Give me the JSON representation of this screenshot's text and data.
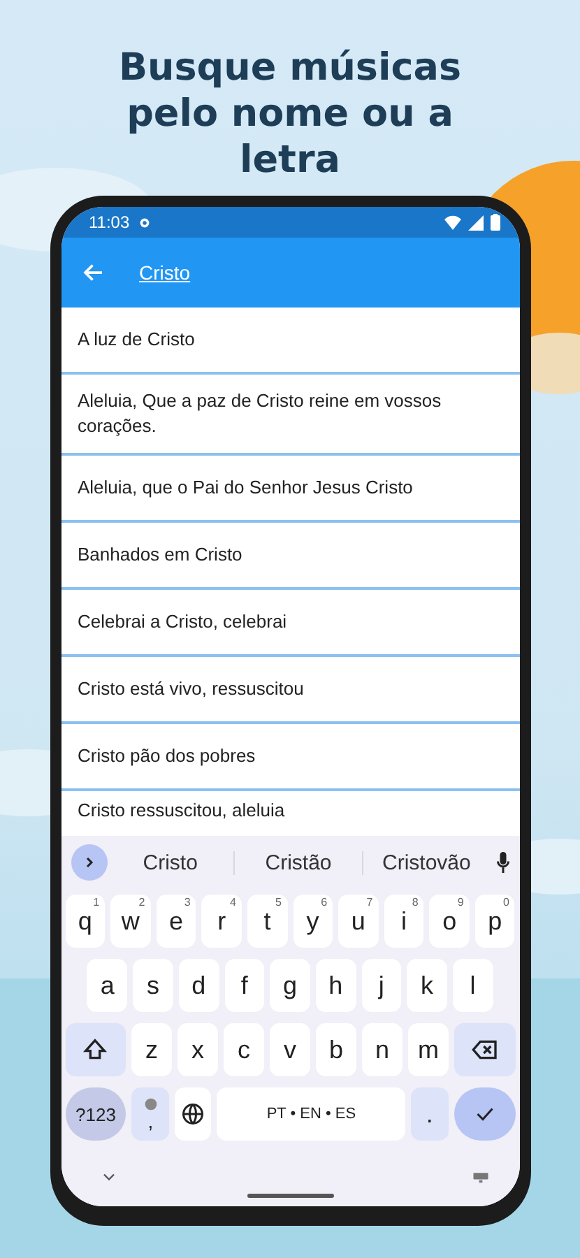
{
  "headline": "Busque músicas pelo nome ou a letra",
  "status_bar": {
    "time": "11:03"
  },
  "app_bar": {
    "title": "Cristo"
  },
  "results": [
    "A luz de Cristo",
    "Aleluia, Que a paz de Cristo reine em vossos corações.",
    "Aleluia, que o Pai do Senhor Jesus Cristo",
    "Banhados em Cristo",
    "Celebrai a Cristo, celebrai",
    "Cristo está vivo, ressuscitou",
    "Cristo pão dos pobres",
    "Cristo ressuscitou, aleluia"
  ],
  "keyboard": {
    "suggestions": [
      "Cristo",
      "Cristão",
      "Cristovão"
    ],
    "rows": [
      [
        {
          "kind": "letter",
          "label": "q",
          "hint": "1"
        },
        {
          "kind": "letter",
          "label": "w",
          "hint": "2"
        },
        {
          "kind": "letter",
          "label": "e",
          "hint": "3"
        },
        {
          "kind": "letter",
          "label": "r",
          "hint": "4"
        },
        {
          "kind": "letter",
          "label": "t",
          "hint": "5"
        },
        {
          "kind": "letter",
          "label": "y",
          "hint": "6"
        },
        {
          "kind": "letter",
          "label": "u",
          "hint": "7"
        },
        {
          "kind": "letter",
          "label": "i",
          "hint": "8"
        },
        {
          "kind": "letter",
          "label": "o",
          "hint": "9"
        },
        {
          "kind": "letter",
          "label": "p",
          "hint": "0"
        }
      ],
      [
        {
          "kind": "letter",
          "label": "a"
        },
        {
          "kind": "letter",
          "label": "s"
        },
        {
          "kind": "letter",
          "label": "d"
        },
        {
          "kind": "letter",
          "label": "f"
        },
        {
          "kind": "letter",
          "label": "g"
        },
        {
          "kind": "letter",
          "label": "h"
        },
        {
          "kind": "letter",
          "label": "j"
        },
        {
          "kind": "letter",
          "label": "k"
        },
        {
          "kind": "letter",
          "label": "l"
        }
      ],
      [
        {
          "kind": "shift"
        },
        {
          "kind": "letter",
          "label": "z"
        },
        {
          "kind": "letter",
          "label": "x"
        },
        {
          "kind": "letter",
          "label": "c"
        },
        {
          "kind": "letter",
          "label": "v"
        },
        {
          "kind": "letter",
          "label": "b"
        },
        {
          "kind": "letter",
          "label": "n"
        },
        {
          "kind": "letter",
          "label": "m"
        },
        {
          "kind": "backspace"
        }
      ]
    ],
    "bottom_row": {
      "symbols_key": "?123",
      "comma_key": ",",
      "space_key": "PT • EN • ES",
      "period_key": "."
    }
  }
}
